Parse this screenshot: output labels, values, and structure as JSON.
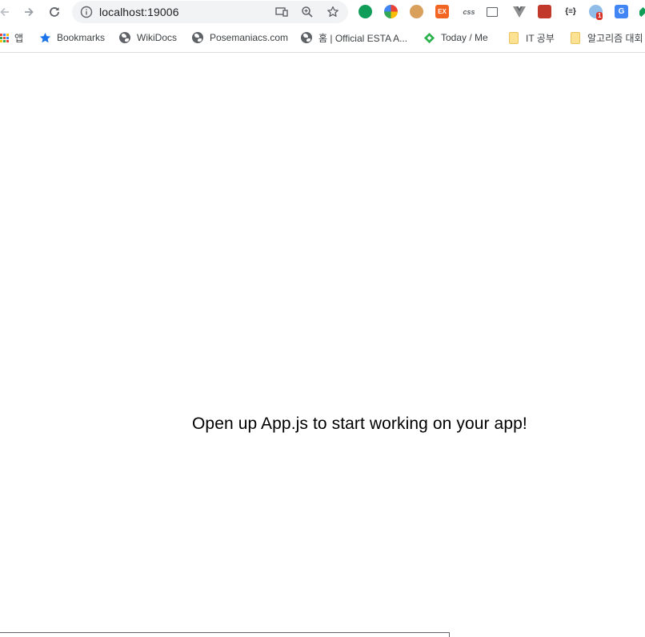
{
  "browser": {
    "address_bar": {
      "url": "localhost:19006"
    },
    "extensions": [
      {
        "name": "hangouts-icon",
        "label": "",
        "color": "#0f9d58"
      },
      {
        "name": "color-wheel-icon",
        "label": "",
        "color": "#e8453c"
      },
      {
        "name": "cookie-icon",
        "label": "",
        "color": "#c58a3b"
      },
      {
        "name": "ex-extension-icon",
        "label": "EX",
        "color": "#f26522"
      },
      {
        "name": "css-extension-icon",
        "label": "css",
        "color": "#5f6368"
      },
      {
        "name": "screen-capture-icon",
        "label": "",
        "color": "#5f6368"
      },
      {
        "name": "vue-devtools-icon",
        "label": "",
        "color": "#8f8f8f"
      },
      {
        "name": "red-extension-icon",
        "label": "",
        "color": "#c0392b"
      },
      {
        "name": "json-viewer-icon",
        "label": "{≡}",
        "color": "#202124"
      },
      {
        "name": "globe-extension-icon",
        "label": "1",
        "color": "#4a90d9"
      },
      {
        "name": "google-translate-icon",
        "label": "G",
        "color": "#4285f4"
      },
      {
        "name": "green-extension-icon",
        "label": "",
        "color": "#0f9d58"
      }
    ]
  },
  "bookmarks": {
    "apps_label": "앱",
    "items": [
      {
        "label": "Bookmarks"
      },
      {
        "label": "WikiDocs"
      },
      {
        "label": "Posemaniacs.com"
      },
      {
        "label": "홈 | Official ESTA A..."
      },
      {
        "label": "Today / Me"
      },
      {
        "label": "IT 공부"
      },
      {
        "label": "알고리즘 대회"
      }
    ]
  },
  "page": {
    "message": "Open up App.js to start working on your app!"
  }
}
